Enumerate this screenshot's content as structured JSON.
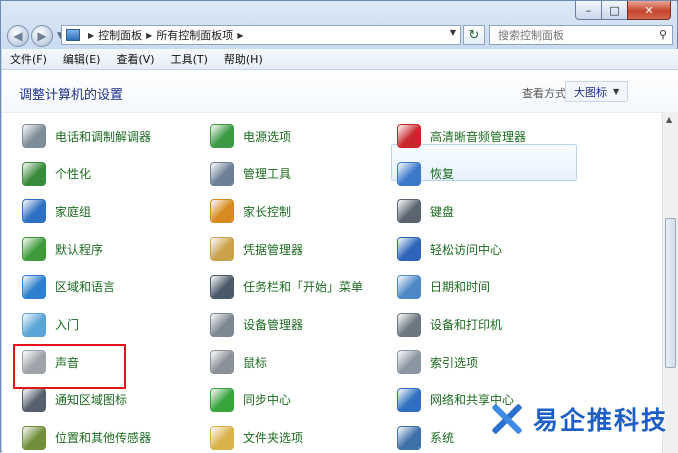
{
  "window": {
    "minimize": "–",
    "maximize": "□",
    "close": "✕"
  },
  "address": {
    "crumbs": [
      "控制面板",
      "所有控制面板项"
    ]
  },
  "search": {
    "placeholder": "搜索控制面板"
  },
  "menu": [
    "文件(F)",
    "编辑(E)",
    "查看(V)",
    "工具(T)",
    "帮助(H)"
  ],
  "header": {
    "title": "调整计算机的设置",
    "view_label": "查看方式:",
    "view_value": "大图标"
  },
  "columns": [
    [
      {
        "label": "电话和调制解调器",
        "icon": "phone-modem-icon",
        "color": "#7f8c99"
      },
      {
        "label": "个性化",
        "icon": "personalization-icon",
        "color": "#3a8a3c"
      },
      {
        "label": "家庭组",
        "icon": "homegroup-icon",
        "color": "#2d6fc2"
      },
      {
        "label": "默认程序",
        "icon": "default-programs-icon",
        "color": "#3f9b3a"
      },
      {
        "label": "区域和语言",
        "icon": "region-language-icon",
        "color": "#2f7fcf"
      },
      {
        "label": "入门",
        "icon": "getting-started-icon",
        "color": "#5aa5d8"
      },
      {
        "label": "声音",
        "icon": "sound-icon",
        "color": "#9ea4aa"
      },
      {
        "label": "通知区域图标",
        "icon": "notification-area-icon",
        "color": "#55606c"
      },
      {
        "label": "位置和其他传感器",
        "icon": "location-sensors-icon",
        "color": "#6f8f3a"
      }
    ],
    [
      {
        "label": "电源选项",
        "icon": "power-options-icon",
        "color": "#3c9a45"
      },
      {
        "label": "管理工具",
        "icon": "admin-tools-icon",
        "color": "#6c7f94"
      },
      {
        "label": "家长控制",
        "icon": "parental-controls-icon",
        "color": "#d68a1f"
      },
      {
        "label": "凭据管理器",
        "icon": "credential-manager-icon",
        "color": "#c9a24a"
      },
      {
        "label": "任务栏和「开始」菜单",
        "icon": "taskbar-start-icon",
        "color": "#4b5a69"
      },
      {
        "label": "设备管理器",
        "icon": "device-manager-icon",
        "color": "#7e8893"
      },
      {
        "label": "鼠标",
        "icon": "mouse-icon",
        "color": "#8a9097"
      },
      {
        "label": "同步中心",
        "icon": "sync-center-icon",
        "color": "#37a43d"
      },
      {
        "label": "文件夹选项",
        "icon": "folder-options-icon",
        "color": "#d9b24a"
      }
    ],
    [
      {
        "label": "高清晰音频管理器",
        "icon": "hd-audio-manager-icon",
        "color": "#c8282d"
      },
      {
        "label": "恢复",
        "icon": "recovery-icon",
        "color": "#3a79c9"
      },
      {
        "label": "键盘",
        "icon": "keyboard-icon",
        "color": "#5b6570"
      },
      {
        "label": "轻松访问中心",
        "icon": "ease-of-access-icon",
        "color": "#2c64b8"
      },
      {
        "label": "日期和时间",
        "icon": "date-time-icon",
        "color": "#4d88c6"
      },
      {
        "label": "设备和打印机",
        "icon": "devices-printers-icon",
        "color": "#6d7782"
      },
      {
        "label": "索引选项",
        "icon": "indexing-options-icon",
        "color": "#8b96a2"
      },
      {
        "label": "网络和共享中心",
        "icon": "network-sharing-icon",
        "color": "#2f6fbf"
      },
      {
        "label": "系统",
        "icon": "system-icon",
        "color": "#3d6fa8"
      }
    ]
  ],
  "watermark": {
    "text": "易企推科技"
  }
}
